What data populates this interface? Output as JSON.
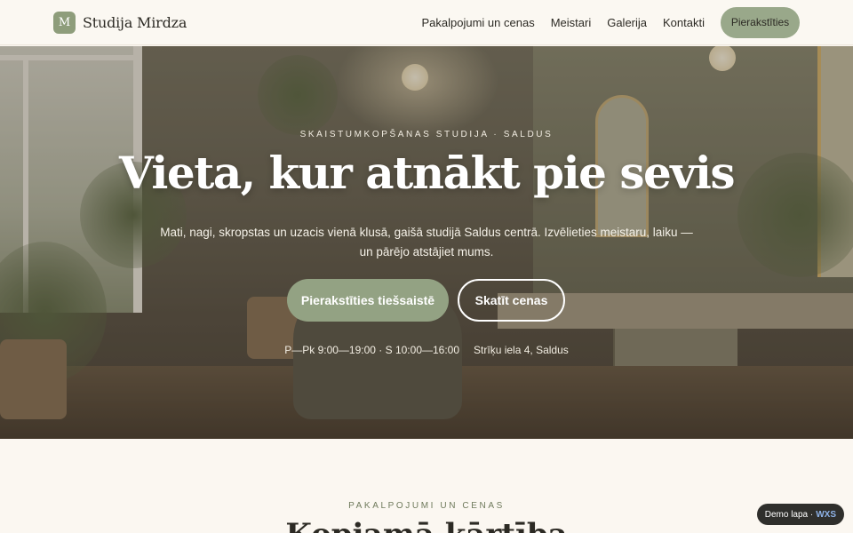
{
  "header": {
    "logo_letter": "M",
    "logo_text": "Studija Mirdza",
    "nav": [
      "Pakalpojumi un cenas",
      "Meistari",
      "Galerija",
      "Kontakti"
    ],
    "cta": "Pierakstīties"
  },
  "hero": {
    "eyebrow": "SKAISTUMKOPŠANAS STUDIJA · SALDUS",
    "title": "Vieta, kur atnākt pie sevis",
    "subtitle": "Mati, nagi, skropstas un uzacis vienā klusā, gaišā studijā Saldus centrā. Izvēlieties meistaru, laiku — un pārējo atstājiet mums.",
    "primary_button": "Pierakstīties tiešsaistē",
    "secondary_button": "Skatīt cenas",
    "hours": "P—Pk 9:00—19:00 · S 10:00—16:00",
    "address": "Strīķu iela 4, Saldus"
  },
  "section": {
    "eyebrow": "PAKALPOJUMI UN CENAS",
    "title": "Kopjamā kārtība"
  },
  "badge": {
    "label": "Demo lapa ·",
    "brand": "WXS"
  }
}
